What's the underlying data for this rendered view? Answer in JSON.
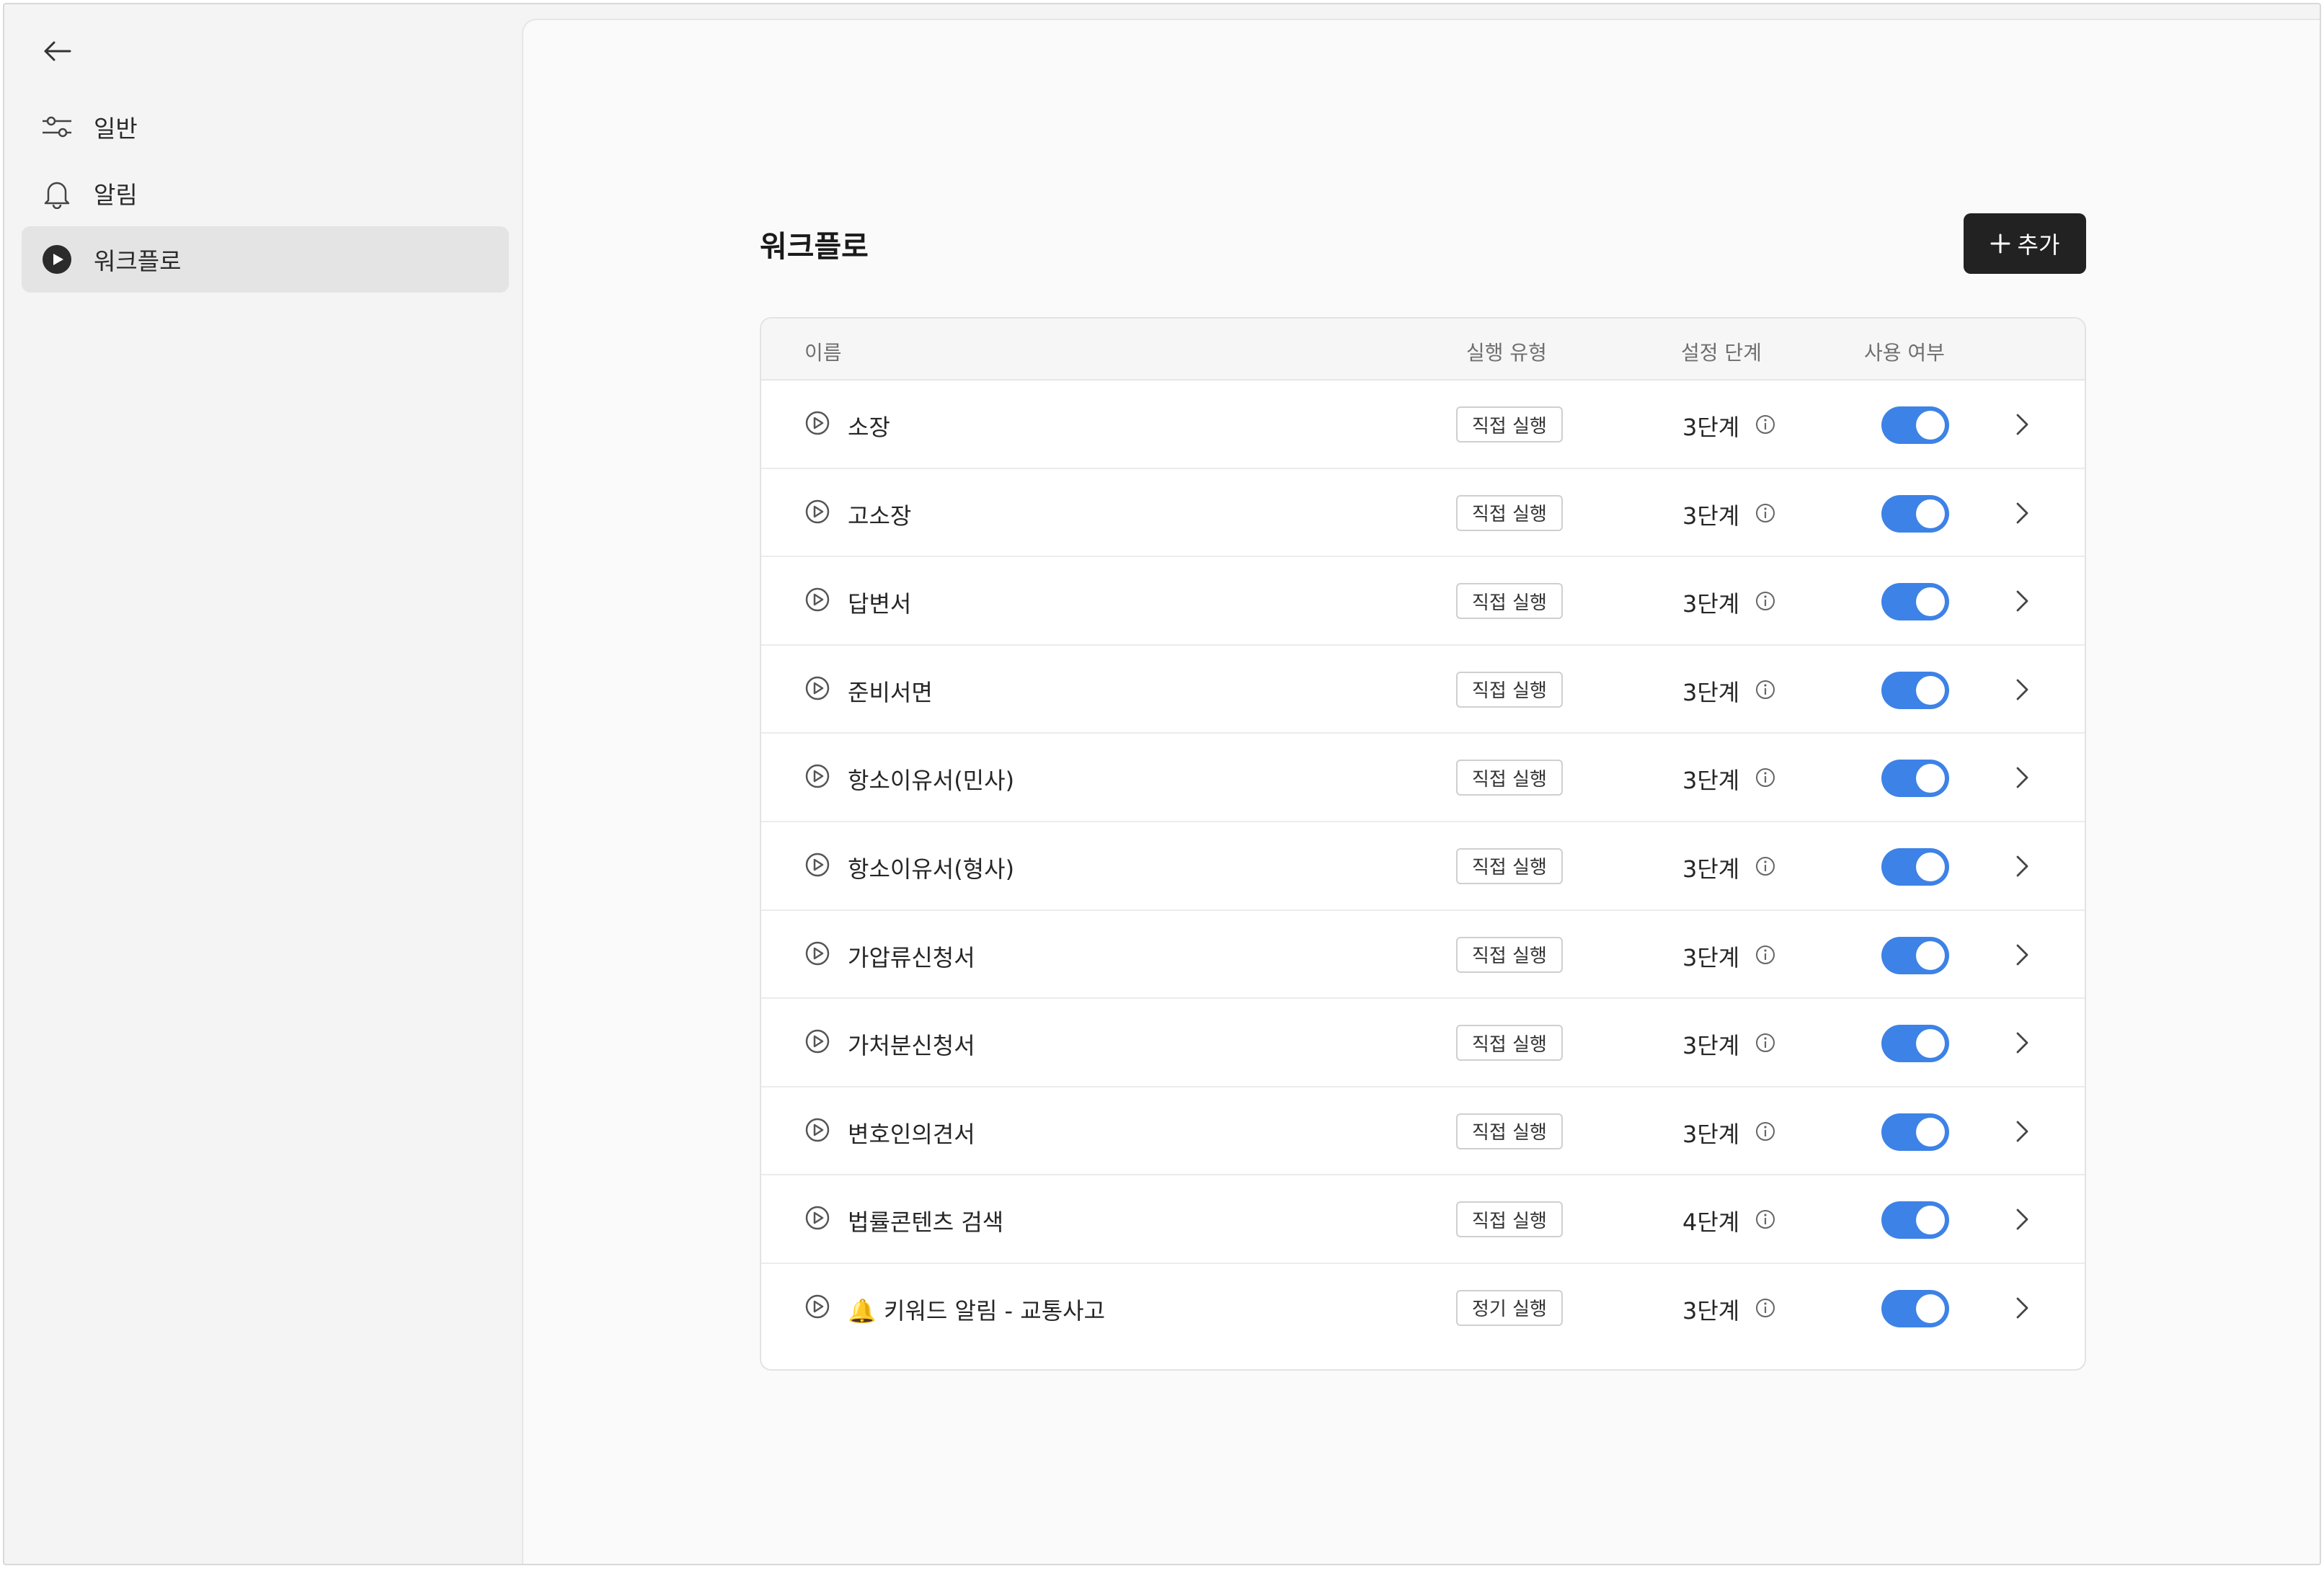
{
  "sidebar": {
    "items": [
      {
        "label": "일반",
        "icon": "sliders-icon"
      },
      {
        "label": "알림",
        "icon": "bell-icon"
      },
      {
        "label": "워크플로",
        "icon": "play-circle-icon",
        "active": true
      }
    ]
  },
  "header": {
    "title": "워크플로",
    "add_label": "추가"
  },
  "table": {
    "columns": {
      "name": "이름",
      "type": "실행 유형",
      "steps": "설정 단계",
      "enabled": "사용 여부"
    },
    "rows": [
      {
        "name": "소장",
        "type": "직접 실행",
        "steps": "3단계",
        "enabled": true
      },
      {
        "name": "고소장",
        "type": "직접 실행",
        "steps": "3단계",
        "enabled": true
      },
      {
        "name": "답변서",
        "type": "직접 실행",
        "steps": "3단계",
        "enabled": true
      },
      {
        "name": "준비서면",
        "type": "직접 실행",
        "steps": "3단계",
        "enabled": true
      },
      {
        "name": "항소이유서(민사)",
        "type": "직접 실행",
        "steps": "3단계",
        "enabled": true
      },
      {
        "name": "항소이유서(형사)",
        "type": "직접 실행",
        "steps": "3단계",
        "enabled": true
      },
      {
        "name": "가압류신청서",
        "type": "직접 실행",
        "steps": "3단계",
        "enabled": true
      },
      {
        "name": "가처분신청서",
        "type": "직접 실행",
        "steps": "3단계",
        "enabled": true
      },
      {
        "name": "변호인의견서",
        "type": "직접 실행",
        "steps": "3단계",
        "enabled": true
      },
      {
        "name": "법률콘텐츠 검색",
        "type": "직접 실행",
        "steps": "4단계",
        "enabled": true
      },
      {
        "name": "🔔 키워드 알림 - 교통사고",
        "type": "정기 실행",
        "steps": "3단계",
        "enabled": true
      }
    ]
  },
  "colors": {
    "toggle_on": "#3d82e6",
    "add_button_bg": "#222222",
    "active_nav_bg": "#e4e4e4"
  }
}
